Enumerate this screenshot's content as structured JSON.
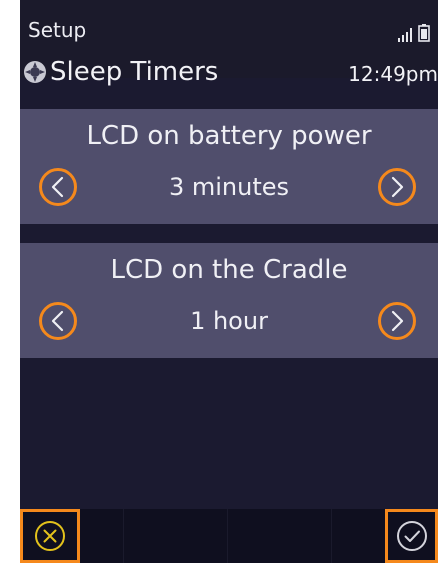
{
  "statusbar": {
    "section": "Setup",
    "signal_icon": "signal-bars-icon",
    "battery_icon": "battery-icon"
  },
  "header": {
    "icon": "sleep-timer-icon",
    "title": "Sleep Timers",
    "time": "12:49pm"
  },
  "settings": [
    {
      "label": "LCD on battery power",
      "value": "3 minutes"
    },
    {
      "label": "LCD on the Cradle",
      "value": "1 hour"
    }
  ],
  "footer": {
    "cancel_icon": "cancel-x-icon",
    "confirm_icon": "confirm-check-icon"
  },
  "colors": {
    "background": "#1b1a30",
    "card": "#504e6c",
    "accent": "#f5891c",
    "cancel_icon": "#e3c21c",
    "text": "#f0f0f5"
  }
}
